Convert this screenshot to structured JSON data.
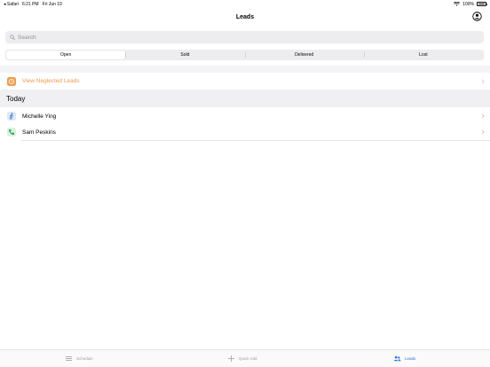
{
  "status_bar": {
    "back_app": "Safari",
    "time": "6:21 PM",
    "date": "Fri Jun 19",
    "battery": "100%",
    "battery_level": 1.0
  },
  "nav": {
    "title": "Leads",
    "account_icon": "person-circle-icon"
  },
  "search": {
    "placeholder": "Search",
    "value": ""
  },
  "segments": [
    {
      "label": "Open",
      "selected": true
    },
    {
      "label": "Sold",
      "selected": false
    },
    {
      "label": "Delivered",
      "selected": false
    },
    {
      "label": "Lost",
      "selected": false
    }
  ],
  "neglected": {
    "label": "View Neglected Leads",
    "icon": "clock-icon",
    "color": "#f2994a"
  },
  "section": {
    "title": "Today"
  },
  "leads": [
    {
      "name": "Michelle Ying",
      "icon": "walk-in-icon",
      "icon_color": "#2f6fd6"
    },
    {
      "name": "Sam Peskins",
      "icon": "phone-icon",
      "icon_color": "#2e9e4f"
    }
  ],
  "tabs": [
    {
      "label": "Schedule",
      "icon": "list-icon",
      "active": false
    },
    {
      "label": "Quick Add",
      "icon": "plus-icon",
      "active": false
    },
    {
      "label": "Leads",
      "icon": "people-icon",
      "active": true
    }
  ],
  "colors": {
    "accent": "#2f6fd6",
    "warning": "#f2994a"
  }
}
